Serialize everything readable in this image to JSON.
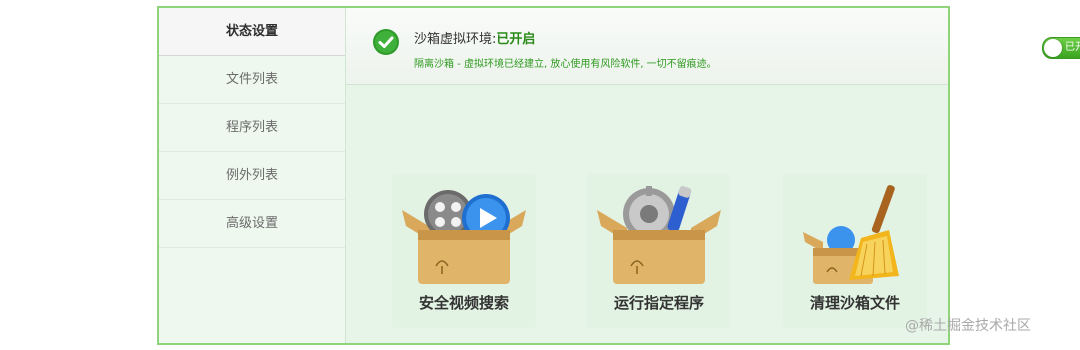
{
  "sidebar": {
    "items": [
      {
        "label": "状态设置",
        "active": true
      },
      {
        "label": "文件列表",
        "active": false
      },
      {
        "label": "程序列表",
        "active": false
      },
      {
        "label": "例外列表",
        "active": false
      },
      {
        "label": "高级设置",
        "active": false
      }
    ]
  },
  "status": {
    "title_prefix": "沙箱虚拟环境:",
    "title_state": "已开启",
    "description": "隔离沙箱 - 虚拟环境已经建立, 放心使用有风险软件, 一切不留痕迹。",
    "toggle_label": "已开启",
    "toggle_on": true,
    "icon": "check-circle-icon"
  },
  "tiles": [
    {
      "label": "安全视频搜索",
      "icon": "video-box-icon"
    },
    {
      "label": "运行指定程序",
      "icon": "program-box-icon"
    },
    {
      "label": "清理沙箱文件",
      "icon": "broom-box-icon"
    }
  ],
  "watermark": "@稀土掘金技术社区",
  "colors": {
    "accent_green": "#3aa421",
    "window_border": "#8fd47a",
    "panel_bg": "#e6f5e7"
  }
}
